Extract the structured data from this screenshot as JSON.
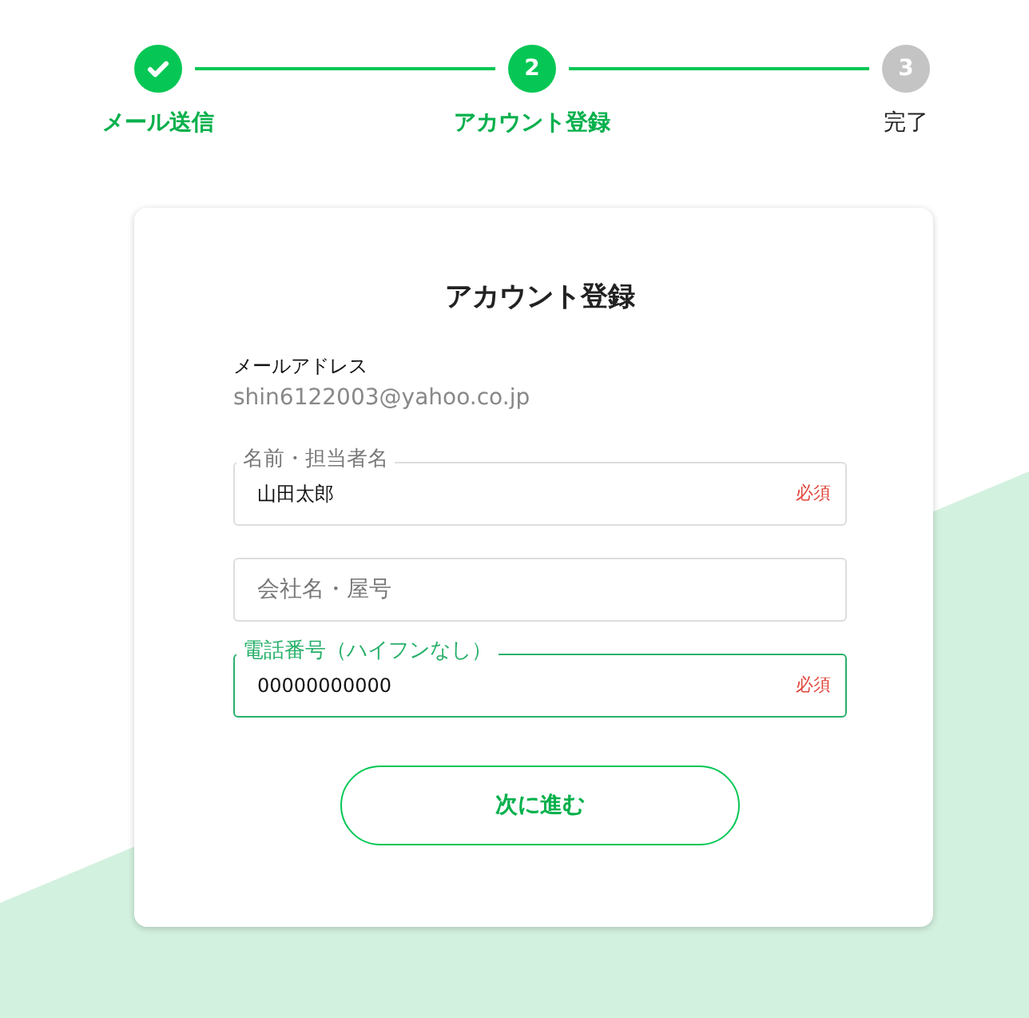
{
  "steps": [
    {
      "label": "メール送信",
      "kind": "done"
    },
    {
      "label": "アカウント登録",
      "kind": "current",
      "number": "2"
    },
    {
      "label": "完了",
      "kind": "pending",
      "number": "3"
    }
  ],
  "card": {
    "title": "アカウント登録",
    "email": {
      "label": "メールアドレス",
      "value": "shin6122003@yahoo.co.jp"
    },
    "fields": [
      {
        "label": "名前・担当者名",
        "value": "山田太郎",
        "required_text": "必須",
        "focused": false
      },
      {
        "placeholder": "会社名・屋号",
        "focused": false
      },
      {
        "label": "電話番号（ハイフンなし）",
        "value": "00000000000",
        "required_text": "必須",
        "focused": true
      }
    ],
    "button": "次に進む"
  }
}
